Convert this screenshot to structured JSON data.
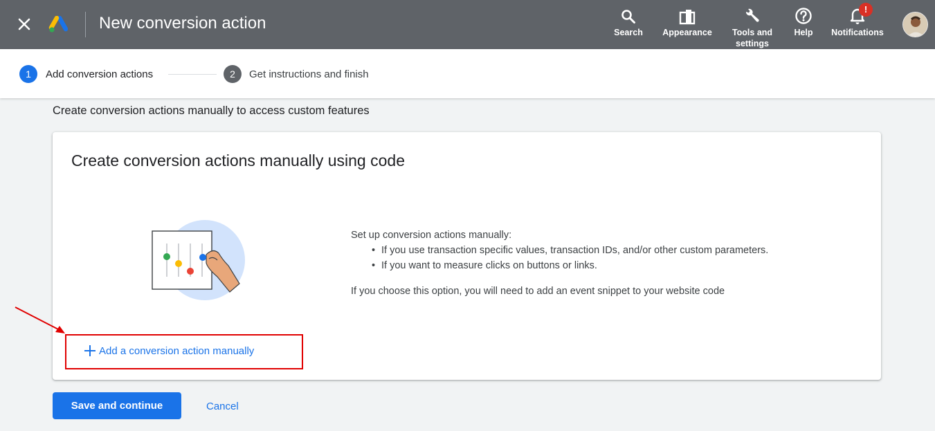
{
  "header": {
    "title": "New conversion action",
    "close_icon": "close-icon",
    "logo_icon": "google-ads-logo",
    "tools": [
      {
        "label": "Search",
        "icon": "search-icon"
      },
      {
        "label": "Appearance",
        "icon": "appearance-icon"
      },
      {
        "label": "Tools and settings",
        "icon": "wrench-icon"
      },
      {
        "label": "Help",
        "icon": "help-icon"
      },
      {
        "label": "Notifications",
        "icon": "bell-icon",
        "badge": "!"
      }
    ],
    "colors": {
      "bar": "#5f6368",
      "badge": "#d93025"
    }
  },
  "stepper": {
    "steps": [
      {
        "number": "1",
        "label": "Add conversion actions",
        "active": true
      },
      {
        "number": "2",
        "label": "Get instructions and finish",
        "active": false
      }
    ]
  },
  "main": {
    "heading": "Create conversion actions manually to access custom features",
    "card": {
      "title": "Create conversion actions manually using code",
      "intro": "Set up conversion actions manually:",
      "bullets": [
        "If you use transaction specific values, transaction IDs, and/or other custom parameters.",
        "If you want to measure clicks on buttons or links."
      ],
      "note": "If you choose this option, you will need to add an event snippet to your website code",
      "add_link": "Add a conversion action manually"
    }
  },
  "footer": {
    "save_label": "Save and continue",
    "cancel_label": "Cancel"
  },
  "colors": {
    "primary": "#1a73e8",
    "annotation": "#e00000"
  }
}
